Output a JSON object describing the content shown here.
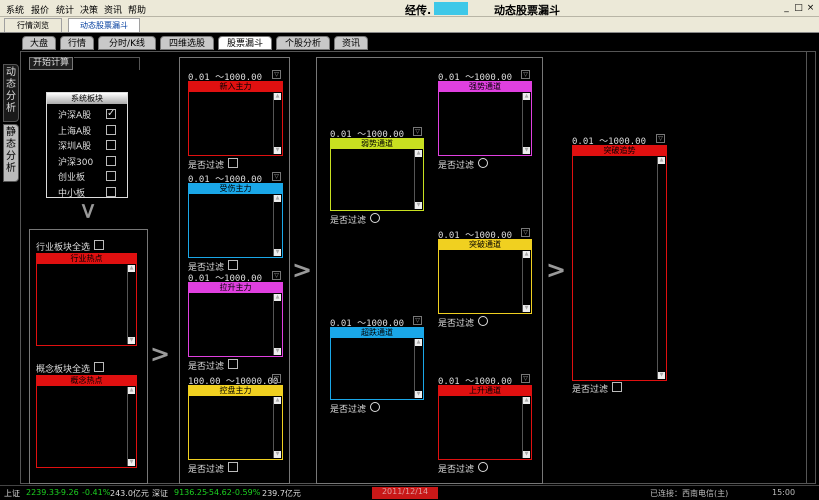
{
  "menu": [
    "系统",
    "报价",
    "统计",
    "决策",
    "资讯",
    "帮助"
  ],
  "app_title_prefix": "经传.",
  "app_title": "动态股票漏斗",
  "window_buttons": [
    "_",
    "□",
    "×"
  ],
  "top_tabs": [
    "行情浏览",
    "动态股票漏斗"
  ],
  "nav_tabs": [
    "大盘",
    "行情",
    "分时/K线",
    "四维选股",
    "股票漏斗",
    "个股分析",
    "资讯"
  ],
  "side_tabs": [
    "动态分析",
    "静态分析"
  ],
  "start_button": "开始计算",
  "system_sectors": {
    "header": "系统板块",
    "items": [
      {
        "label": "沪深A股",
        "checked": true
      },
      {
        "label": "上海A股",
        "checked": false
      },
      {
        "label": "深圳A股",
        "checked": false
      },
      {
        "label": "沪深300",
        "checked": false
      },
      {
        "label": "创业板",
        "checked": false
      },
      {
        "label": "中小板",
        "checked": false
      }
    ]
  },
  "industry": {
    "select_all": "行业板块全选",
    "box_title": "行业热点"
  },
  "concept": {
    "select_all": "概念板块全选",
    "box_title": "概念热点"
  },
  "filter_label": "是否过滤",
  "col1": [
    {
      "range": "0.01 ～1000.00",
      "title": "新入主力",
      "color": "#e01010"
    },
    {
      "range": "0.01 ～1000.00",
      "title": "受伤主力",
      "color": "#1aa7e8"
    },
    {
      "range": "0.01 ～1000.00",
      "title": "拉升主力",
      "color": "#e040e0"
    },
    {
      "range": "100.00 ～10000.00",
      "title": "控盘主力",
      "color": "#f0d020"
    }
  ],
  "col2": [
    {
      "range": "0.01 ～1000.00",
      "title": "弱势通道",
      "color": "#c8e020"
    },
    {
      "range": "0.01 ～1000.00",
      "title": "超跌通道",
      "color": "#1aa7e8"
    }
  ],
  "col3": [
    {
      "range": "0.01 ～1000.00",
      "title": "强势通道",
      "color": "#e040e0"
    },
    {
      "range": "0.01 ～1000.00",
      "title": "突破通道",
      "color": "#f0d020"
    },
    {
      "range": "0.01 ～1000.00",
      "title": "上升通道",
      "color": "#e01010"
    }
  ],
  "col4": {
    "range": "0.01 ～1000.00",
    "title": "突破追势",
    "color": "#e01010"
  },
  "status": {
    "sh_label": "上证",
    "sh_value": "2239.33",
    "sh_change": "-9.26",
    "sh_pct": "-0.41%",
    "sh_amount": "243.0亿元",
    "sz_label": "深证",
    "sz_value": "9136.25",
    "sz_change": "-54.62",
    "sz_pct": "-0.59%",
    "sz_amount": "239.7亿元",
    "date": "2011/12/14",
    "connection": "已连接：西南电信(主)",
    "time": "15:00"
  }
}
